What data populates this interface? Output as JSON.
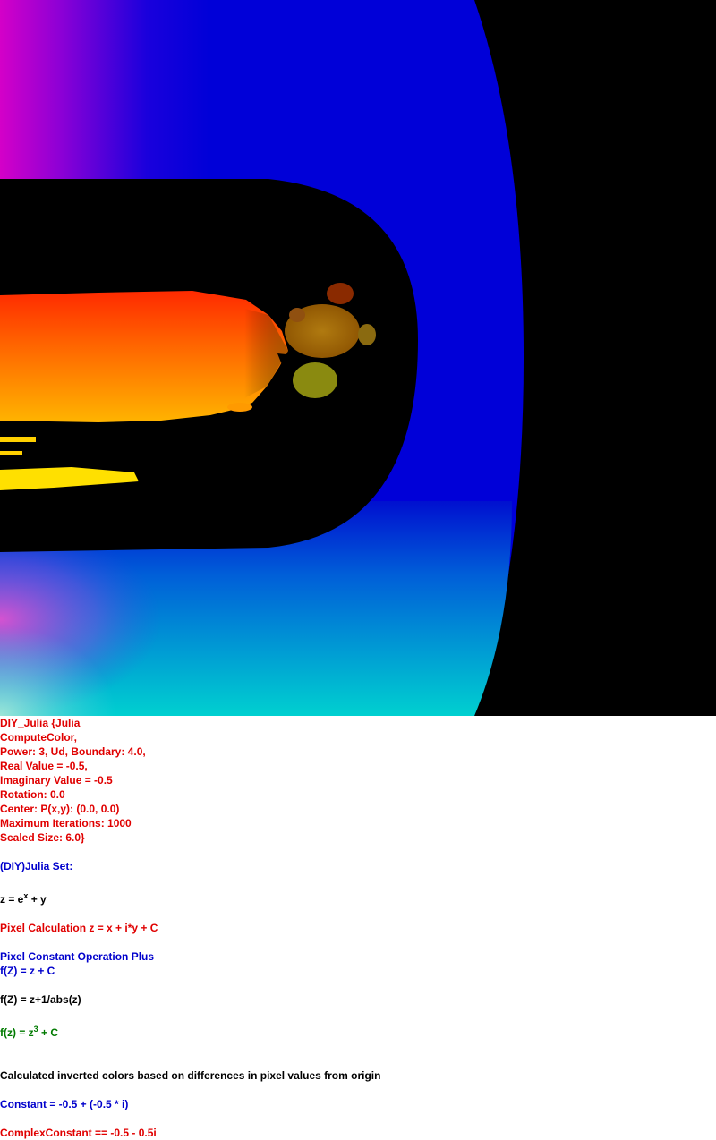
{
  "params": {
    "title": "DIY_Julia {Julia",
    "compute": "ComputeColor,",
    "power": "Power: 3, Ud, Boundary: 4.0,",
    "real": "Real Value = -0.5,",
    "imaginary": "Imaginary Value = -0.5",
    "rotation": "Rotation: 0.0",
    "center": "Center: P(x,y): (0.0, 0.0)",
    "max_iter": "Maximum Iterations: 1000",
    "scaled": "Scaled Size: 6.0}"
  },
  "set_heading": "(DIY)Julia Set:",
  "formula": {
    "base": "z = e",
    "exp": "x",
    "rest": " + y"
  },
  "pixel_calc": "Pixel Calculation z = x + i*y + C",
  "constant_op": "Pixel Constant Operation Plus",
  "fz_plus": "f(Z) = z + C",
  "fz_abs": "f(Z) = z+1/abs(z)",
  "fz_pow": {
    "base": "f(z) = z",
    "exp": "3",
    "rest": " + C"
  },
  "inverted_note": "Calculated inverted colors based on differences in pixel values from origin",
  "constant": "Constant = -0.5 + (-0.5 * i)",
  "complex_constant": "ComplexConstant == -0.5 - 0.5i"
}
